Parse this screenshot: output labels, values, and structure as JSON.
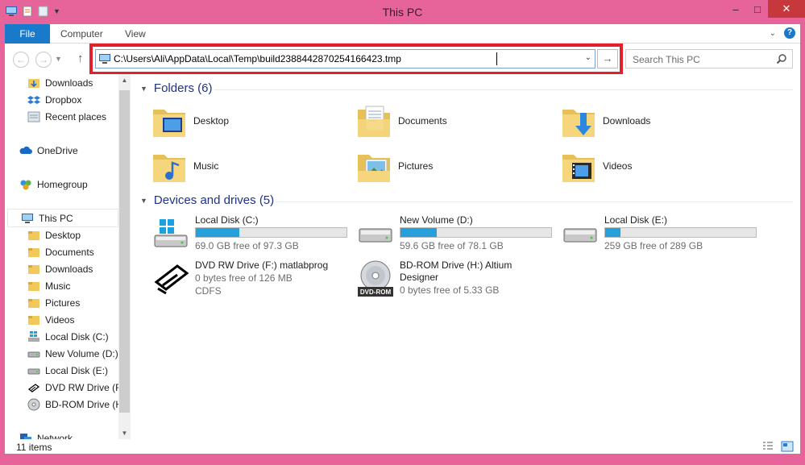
{
  "window": {
    "title": "This PC"
  },
  "ribbon": {
    "tabs": [
      "File",
      "Computer",
      "View"
    ]
  },
  "address": {
    "path": "C:\\Users\\Ali\\AppData\\Local\\Temp\\build2388442870254166423.tmp"
  },
  "search": {
    "placeholder": "Search This PC"
  },
  "sidebar": {
    "items": [
      {
        "label": "Downloads",
        "icon": "downloads-folder-icon"
      },
      {
        "label": "Dropbox",
        "icon": "dropbox-icon"
      },
      {
        "label": "Recent places",
        "icon": "recent-places-icon"
      },
      {
        "label": "OneDrive",
        "icon": "onedrive-icon"
      },
      {
        "label": "Homegroup",
        "icon": "homegroup-icon"
      },
      {
        "label": "This PC",
        "icon": "this-pc-icon"
      },
      {
        "label": "Desktop",
        "icon": "folder-icon"
      },
      {
        "label": "Documents",
        "icon": "folder-icon"
      },
      {
        "label": "Downloads",
        "icon": "folder-icon"
      },
      {
        "label": "Music",
        "icon": "folder-icon"
      },
      {
        "label": "Pictures",
        "icon": "folder-icon"
      },
      {
        "label": "Videos",
        "icon": "folder-icon"
      },
      {
        "label": "Local Disk (C:)",
        "icon": "windows-drive-icon"
      },
      {
        "label": "New Volume (D:)",
        "icon": "drive-icon"
      },
      {
        "label": "Local Disk (E:)",
        "icon": "drive-icon"
      },
      {
        "label": "DVD RW Drive (F:",
        "icon": "dvd-drive-icon"
      },
      {
        "label": "BD-ROM Drive (H",
        "icon": "bd-drive-icon"
      },
      {
        "label": "Network",
        "icon": "network-icon"
      }
    ]
  },
  "folders": {
    "header": "Folders (6)",
    "items": [
      {
        "label": "Desktop",
        "overlay": "desktop"
      },
      {
        "label": "Documents",
        "overlay": "documents"
      },
      {
        "label": "Downloads",
        "overlay": "downloads"
      },
      {
        "label": "Music",
        "overlay": "music"
      },
      {
        "label": "Pictures",
        "overlay": "pictures"
      },
      {
        "label": "Videos",
        "overlay": "videos"
      }
    ]
  },
  "drives": {
    "header": "Devices and drives (5)",
    "items": [
      {
        "label": "Local Disk (C:)",
        "free": "69.0 GB free of 97.3 GB",
        "used_fraction": 0.29,
        "icon": "windows-drive-icon"
      },
      {
        "label": "New Volume (D:)",
        "free": "59.6 GB free of 78.1 GB",
        "used_fraction": 0.24,
        "icon": "drive-icon"
      },
      {
        "label": "Local Disk (E:)",
        "free": "259 GB free of 289 GB",
        "used_fraction": 0.1,
        "icon": "drive-icon"
      }
    ],
    "optical": [
      {
        "label": "DVD RW Drive (F:) matlabprog",
        "free": "0 bytes free of 126 MB",
        "fs": "CDFS",
        "icon": "dvd-drive-icon"
      },
      {
        "label": "BD-ROM Drive (H:) Altium Designer",
        "free": "0 bytes free of 5.33 GB",
        "icon": "bd-drive-icon",
        "badge": "DVD-ROM"
      }
    ]
  },
  "status": {
    "items": "11 items"
  },
  "colors": {
    "accent": "#1979ca",
    "frame": "#e6649a",
    "highlight": "#e0202a",
    "bar_fill": "#26a0da"
  }
}
